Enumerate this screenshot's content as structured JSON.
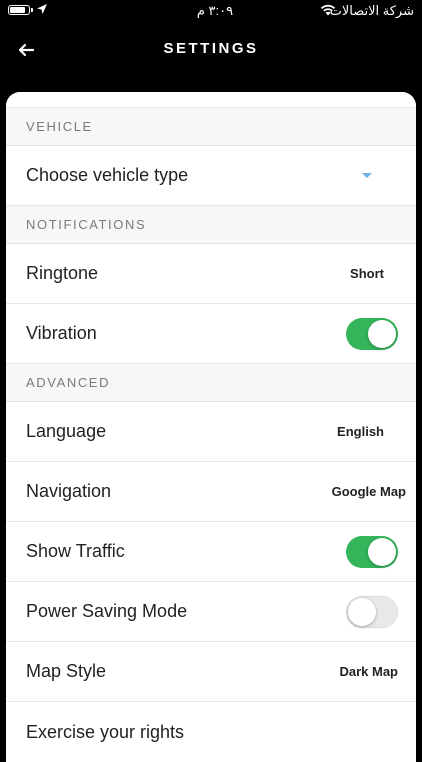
{
  "status_bar": {
    "time": "٣:٠٩ م",
    "carrier": "شركة الاتصالات",
    "battery_level": 0.85
  },
  "header": {
    "title": "SETTINGS"
  },
  "sections": {
    "vehicle": {
      "title": "VEHICLE",
      "choose_vehicle_label": "Choose vehicle type"
    },
    "notifications": {
      "title": "NOTIFICATIONS",
      "ringtone_label": "Ringtone",
      "ringtone_value": "Short",
      "vibration_label": "Vibration",
      "vibration_on": true
    },
    "advanced": {
      "title": "ADVANCED",
      "language_label": "Language",
      "language_value": "English",
      "navigation_label": "Navigation",
      "navigation_value": "Google Map",
      "show_traffic_label": "Show Traffic",
      "show_traffic_on": true,
      "power_saving_label": "Power Saving Mode",
      "power_saving_on": false,
      "map_style_label": "Map Style",
      "map_style_value": "Dark Map",
      "exercise_rights_label": "Exercise your rights"
    }
  },
  "colors": {
    "toggle_on": "#34b55a",
    "toggle_off": "#e9e9ea",
    "dropdown_caret": "#6cb4e0"
  }
}
